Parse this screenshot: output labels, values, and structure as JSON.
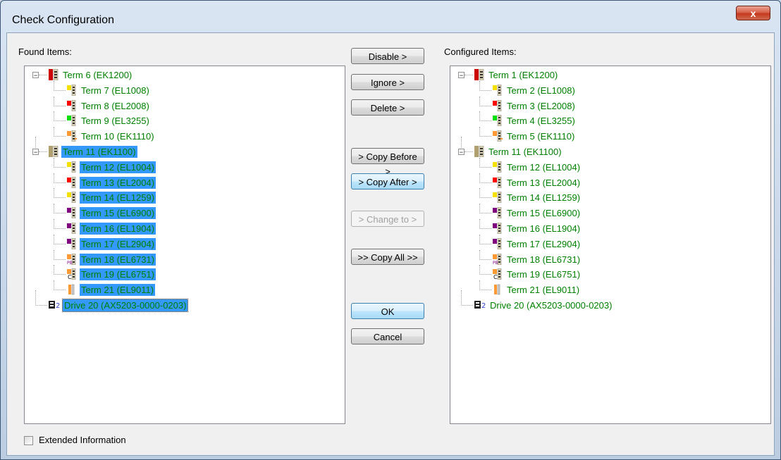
{
  "window": {
    "title": "Check Configuration",
    "close_label": "x"
  },
  "found": {
    "label": "Found Items:",
    "nodes": [
      {
        "text": "Term 6 (EK1200)",
        "level": 0,
        "icon": "coupler-red",
        "expander": "minus"
      },
      {
        "text": "Term 7 (EL1008)",
        "level": 1,
        "icon": "terminal-yellow"
      },
      {
        "text": "Term 8 (EL2008)",
        "level": 1,
        "icon": "terminal-red"
      },
      {
        "text": "Term 9 (EL3255)",
        "level": 1,
        "icon": "terminal-green"
      },
      {
        "text": "Term 10 (EK1110)",
        "level": 1,
        "icon": "terminal-orange-ext"
      },
      {
        "text": "Term 11 (EK1100)",
        "level": 0,
        "icon": "coupler-grey",
        "expander": "minus",
        "selected": true
      },
      {
        "text": "Term 12 (EL1004)",
        "level": 1,
        "icon": "terminal-yellow",
        "selected": true
      },
      {
        "text": "Term 13 (EL2004)",
        "level": 1,
        "icon": "terminal-red",
        "selected": true
      },
      {
        "text": "Term 14 (EL1259)",
        "level": 1,
        "icon": "terminal-yellow",
        "selected": true
      },
      {
        "text": "Term 15 (EL6900)",
        "level": 1,
        "icon": "terminal-purple",
        "selected": true
      },
      {
        "text": "Term 16 (EL1904)",
        "level": 1,
        "icon": "terminal-purple",
        "selected": true
      },
      {
        "text": "Term 17 (EL2904)",
        "level": 1,
        "icon": "terminal-purple",
        "selected": true
      },
      {
        "text": "Term 18 (EL6731)",
        "level": 1,
        "icon": "terminal-pb",
        "selected": true
      },
      {
        "text": "Term 19 (EL6751)",
        "level": 1,
        "icon": "terminal-c",
        "selected": true
      },
      {
        "text": "Term 21 (EL9011)",
        "level": 1,
        "icon": "terminal-end",
        "selected": true
      },
      {
        "text": "Drive 20 (AX5203-0000-0203)",
        "level": 0,
        "icon": "drive",
        "selected": true,
        "focus": true
      }
    ]
  },
  "configured": {
    "label": "Configured Items:",
    "nodes": [
      {
        "text": "Term 1 (EK1200)",
        "level": 0,
        "icon": "coupler-red",
        "expander": "minus"
      },
      {
        "text": "Term 2 (EL1008)",
        "level": 1,
        "icon": "terminal-yellow"
      },
      {
        "text": "Term 3 (EL2008)",
        "level": 1,
        "icon": "terminal-red"
      },
      {
        "text": "Term 4 (EL3255)",
        "level": 1,
        "icon": "terminal-green"
      },
      {
        "text": "Term 5 (EK1110)",
        "level": 1,
        "icon": "terminal-orange-ext"
      },
      {
        "text": "Term 11 (EK1100)",
        "level": 0,
        "icon": "coupler-grey",
        "expander": "minus"
      },
      {
        "text": "Term 12 (EL1004)",
        "level": 1,
        "icon": "terminal-yellow"
      },
      {
        "text": "Term 13 (EL2004)",
        "level": 1,
        "icon": "terminal-red"
      },
      {
        "text": "Term 14 (EL1259)",
        "level": 1,
        "icon": "terminal-yellow"
      },
      {
        "text": "Term 15 (EL6900)",
        "level": 1,
        "icon": "terminal-purple"
      },
      {
        "text": "Term 16 (EL1904)",
        "level": 1,
        "icon": "terminal-purple"
      },
      {
        "text": "Term 17 (EL2904)",
        "level": 1,
        "icon": "terminal-purple"
      },
      {
        "text": "Term 18 (EL6731)",
        "level": 1,
        "icon": "terminal-pb"
      },
      {
        "text": "Term 19 (EL6751)",
        "level": 1,
        "icon": "terminal-c"
      },
      {
        "text": "Term 21 (EL9011)",
        "level": 1,
        "icon": "terminal-end"
      },
      {
        "text": "Drive 20 (AX5203-0000-0203)",
        "level": 0,
        "icon": "drive"
      }
    ]
  },
  "buttons": {
    "disable": "Disable >",
    "ignore": "Ignore >",
    "delete": "Delete >",
    "copy_before": "> Copy Before >",
    "copy_after": "> Copy After >",
    "change_to": "> Change to >",
    "copy_all": ">> Copy All >>",
    "ok": "OK",
    "cancel": "Cancel"
  },
  "extended": {
    "label": "Extended Information",
    "checked": false
  },
  "colors": {
    "node_text": "#008000",
    "selection": "#3399ff"
  }
}
